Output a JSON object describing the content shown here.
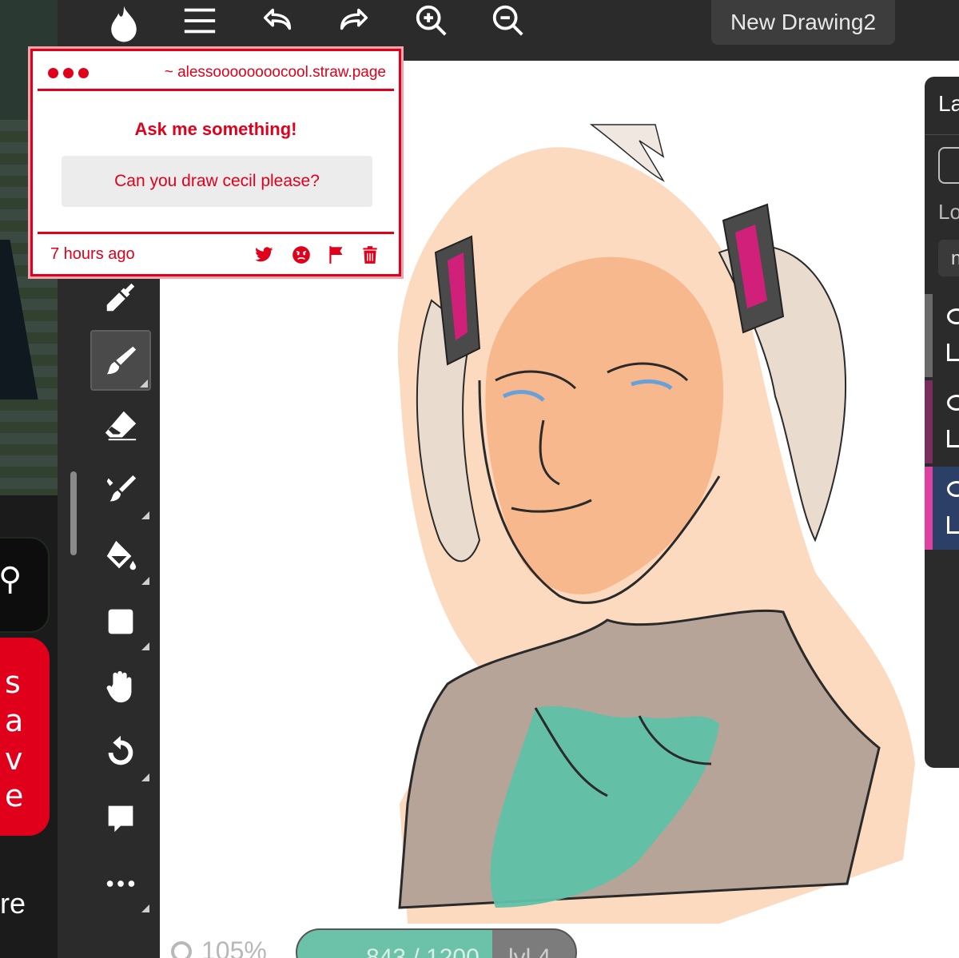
{
  "app": {
    "document_title": "New Drawing2",
    "layers_title": "La",
    "layers_label": "Lo",
    "layers_field": "n"
  },
  "toolbar": {
    "tools": [
      "eyedropper-icon",
      "brush-icon",
      "eraser-icon",
      "smudge-icon",
      "fill-bucket-icon",
      "shape-icon",
      "hand-icon",
      "undo-history-icon",
      "comment-icon",
      "more-icon"
    ],
    "top_icons": [
      "logo-icon",
      "menu-icon",
      "undo-icon",
      "redo-icon",
      "zoom-in-icon",
      "zoom-out-icon"
    ]
  },
  "status": {
    "zoom": "105%",
    "xp_text": "843 / 1200",
    "xp_fraction": 0.7025,
    "level": "lvl 4"
  },
  "popup": {
    "url": "~ alessoooooooocool.straw.page",
    "heading": "Ask me something!",
    "question": "Can you draw cecil please?",
    "time": "7 hours ago",
    "accent_color": "#e0001b"
  },
  "background_app": {
    "save_letters": [
      "s",
      "a",
      "v",
      "e"
    ],
    "trailing_text": "re"
  },
  "layers": {
    "stripe_colors": [
      "#6a6a6a",
      "#7a2e5f",
      "#e040a0"
    ]
  }
}
